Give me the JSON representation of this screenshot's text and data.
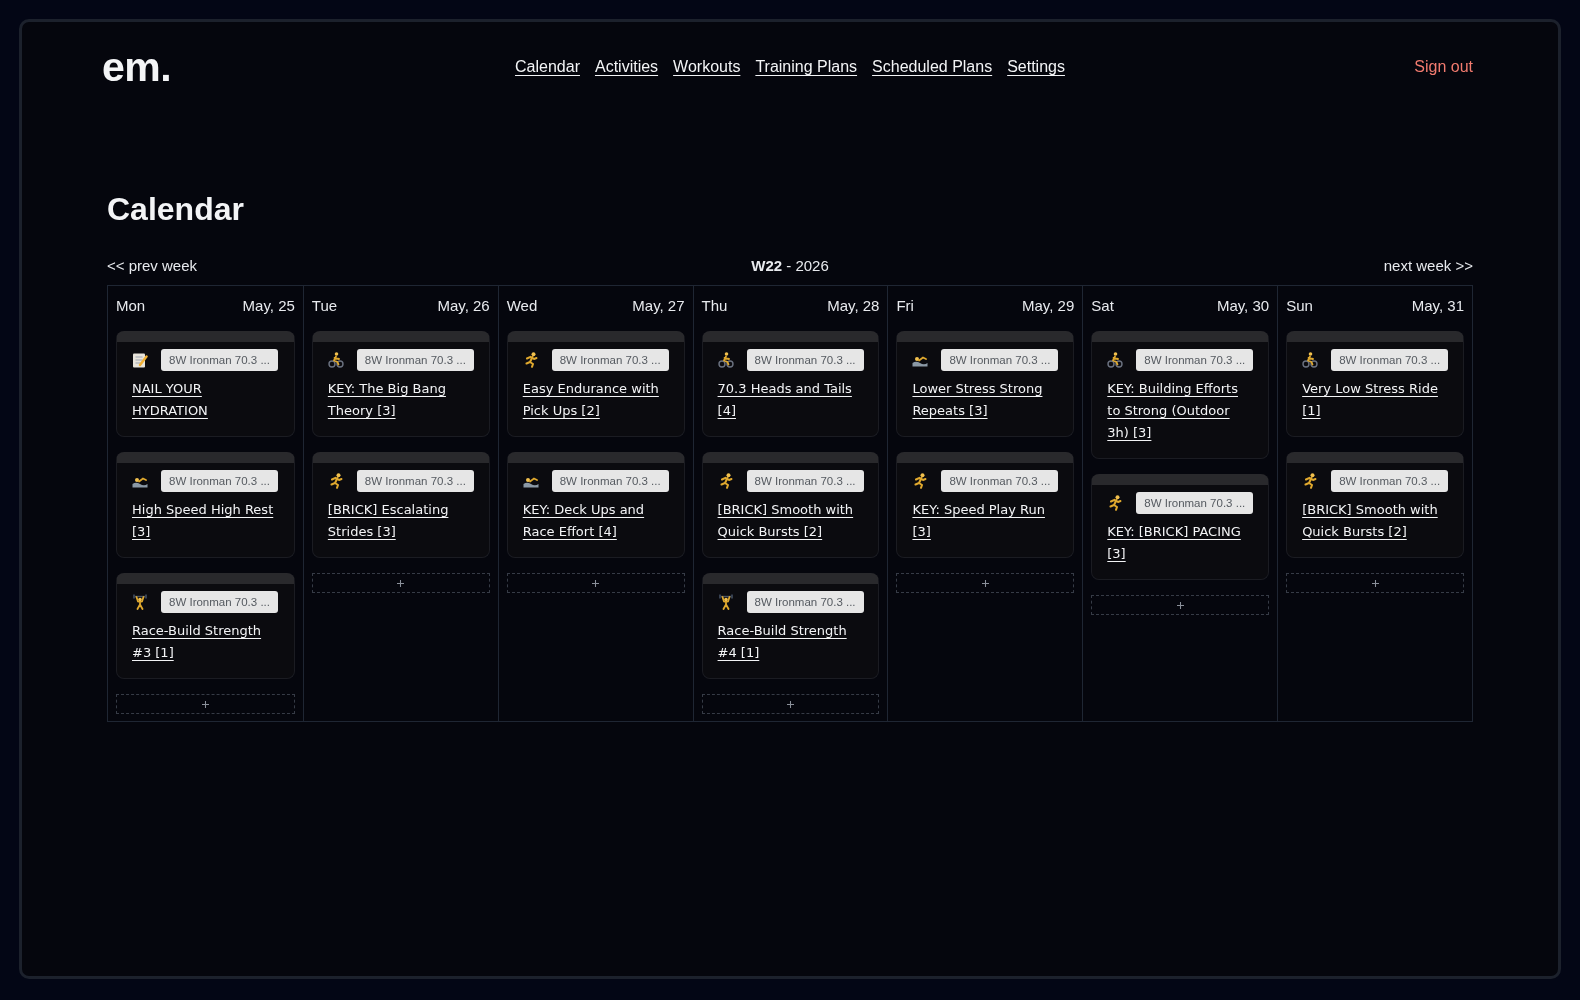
{
  "header": {
    "logo": "em.",
    "nav": [
      "Calendar",
      "Activities",
      "Workouts",
      "Training Plans",
      "Scheduled Plans",
      "Settings"
    ],
    "sign_out": "Sign out"
  },
  "page_title": "Calendar",
  "week_nav": {
    "prev": "<< prev week",
    "label": "**W22** - 2026",
    "next": "next week >>"
  },
  "days": [
    {
      "day": "Mon",
      "date": "May, 25",
      "workouts": [
        {
          "kind": "note",
          "plan": "8W Ironman 70.3 ...",
          "title": "NAIL YOUR HYDRATION"
        },
        {
          "kind": "swim",
          "plan": "8W Ironman 70.3 ...",
          "title": "High Speed High Rest [3]"
        },
        {
          "kind": "strength",
          "plan": "8W Ironman 70.3 ...",
          "title": "Race-Build Strength #3 [1]"
        }
      ]
    },
    {
      "day": "Tue",
      "date": "May, 26",
      "workouts": [
        {
          "kind": "bike",
          "plan": "8W Ironman 70.3 ...",
          "title": "KEY: The Big Bang Theory [3]"
        },
        {
          "kind": "run",
          "plan": "8W Ironman 70.3 ...",
          "title": "[BRICK] Escalating Strides [3]"
        }
      ]
    },
    {
      "day": "Wed",
      "date": "May, 27",
      "workouts": [
        {
          "kind": "run",
          "plan": "8W Ironman 70.3 ...",
          "title": "Easy Endurance with Pick Ups [2]"
        },
        {
          "kind": "swim",
          "plan": "8W Ironman 70.3 ...",
          "title": "KEY: Deck Ups and Race Effort [4]"
        }
      ]
    },
    {
      "day": "Thu",
      "date": "May, 28",
      "workouts": [
        {
          "kind": "bike",
          "plan": "8W Ironman 70.3 ...",
          "title": "70.3 Heads and Tails [4]"
        },
        {
          "kind": "run",
          "plan": "8W Ironman 70.3 ...",
          "title": "[BRICK] Smooth with Quick Bursts [2]"
        },
        {
          "kind": "strength",
          "plan": "8W Ironman 70.3 ...",
          "title": "Race-Build Strength #4 [1]"
        }
      ]
    },
    {
      "day": "Fri",
      "date": "May, 29",
      "workouts": [
        {
          "kind": "swim",
          "plan": "8W Ironman 70.3 ...",
          "title": "Lower Stress Strong Repeats [3]"
        },
        {
          "kind": "run",
          "plan": "8W Ironman 70.3 ...",
          "title": "KEY: Speed Play Run [3]"
        }
      ]
    },
    {
      "day": "Sat",
      "date": "May, 30",
      "workouts": [
        {
          "kind": "bike",
          "plan": "8W Ironman 70.3 ...",
          "title": "KEY: Building Efforts to Strong (Outdoor 3h) [3]"
        },
        {
          "kind": "run",
          "plan": "8W Ironman 70.3 ...",
          "title": "KEY: [BRICK] PACING [3]"
        }
      ]
    },
    {
      "day": "Sun",
      "date": "May, 31",
      "workouts": [
        {
          "kind": "bike",
          "plan": "8W Ironman 70.3 ...",
          "title": "Very Low Stress Ride [1]"
        },
        {
          "kind": "run",
          "plan": "8W Ironman 70.3 ...",
          "title": "[BRICK] Smooth with Quick Bursts [2]"
        }
      ]
    }
  ]
}
